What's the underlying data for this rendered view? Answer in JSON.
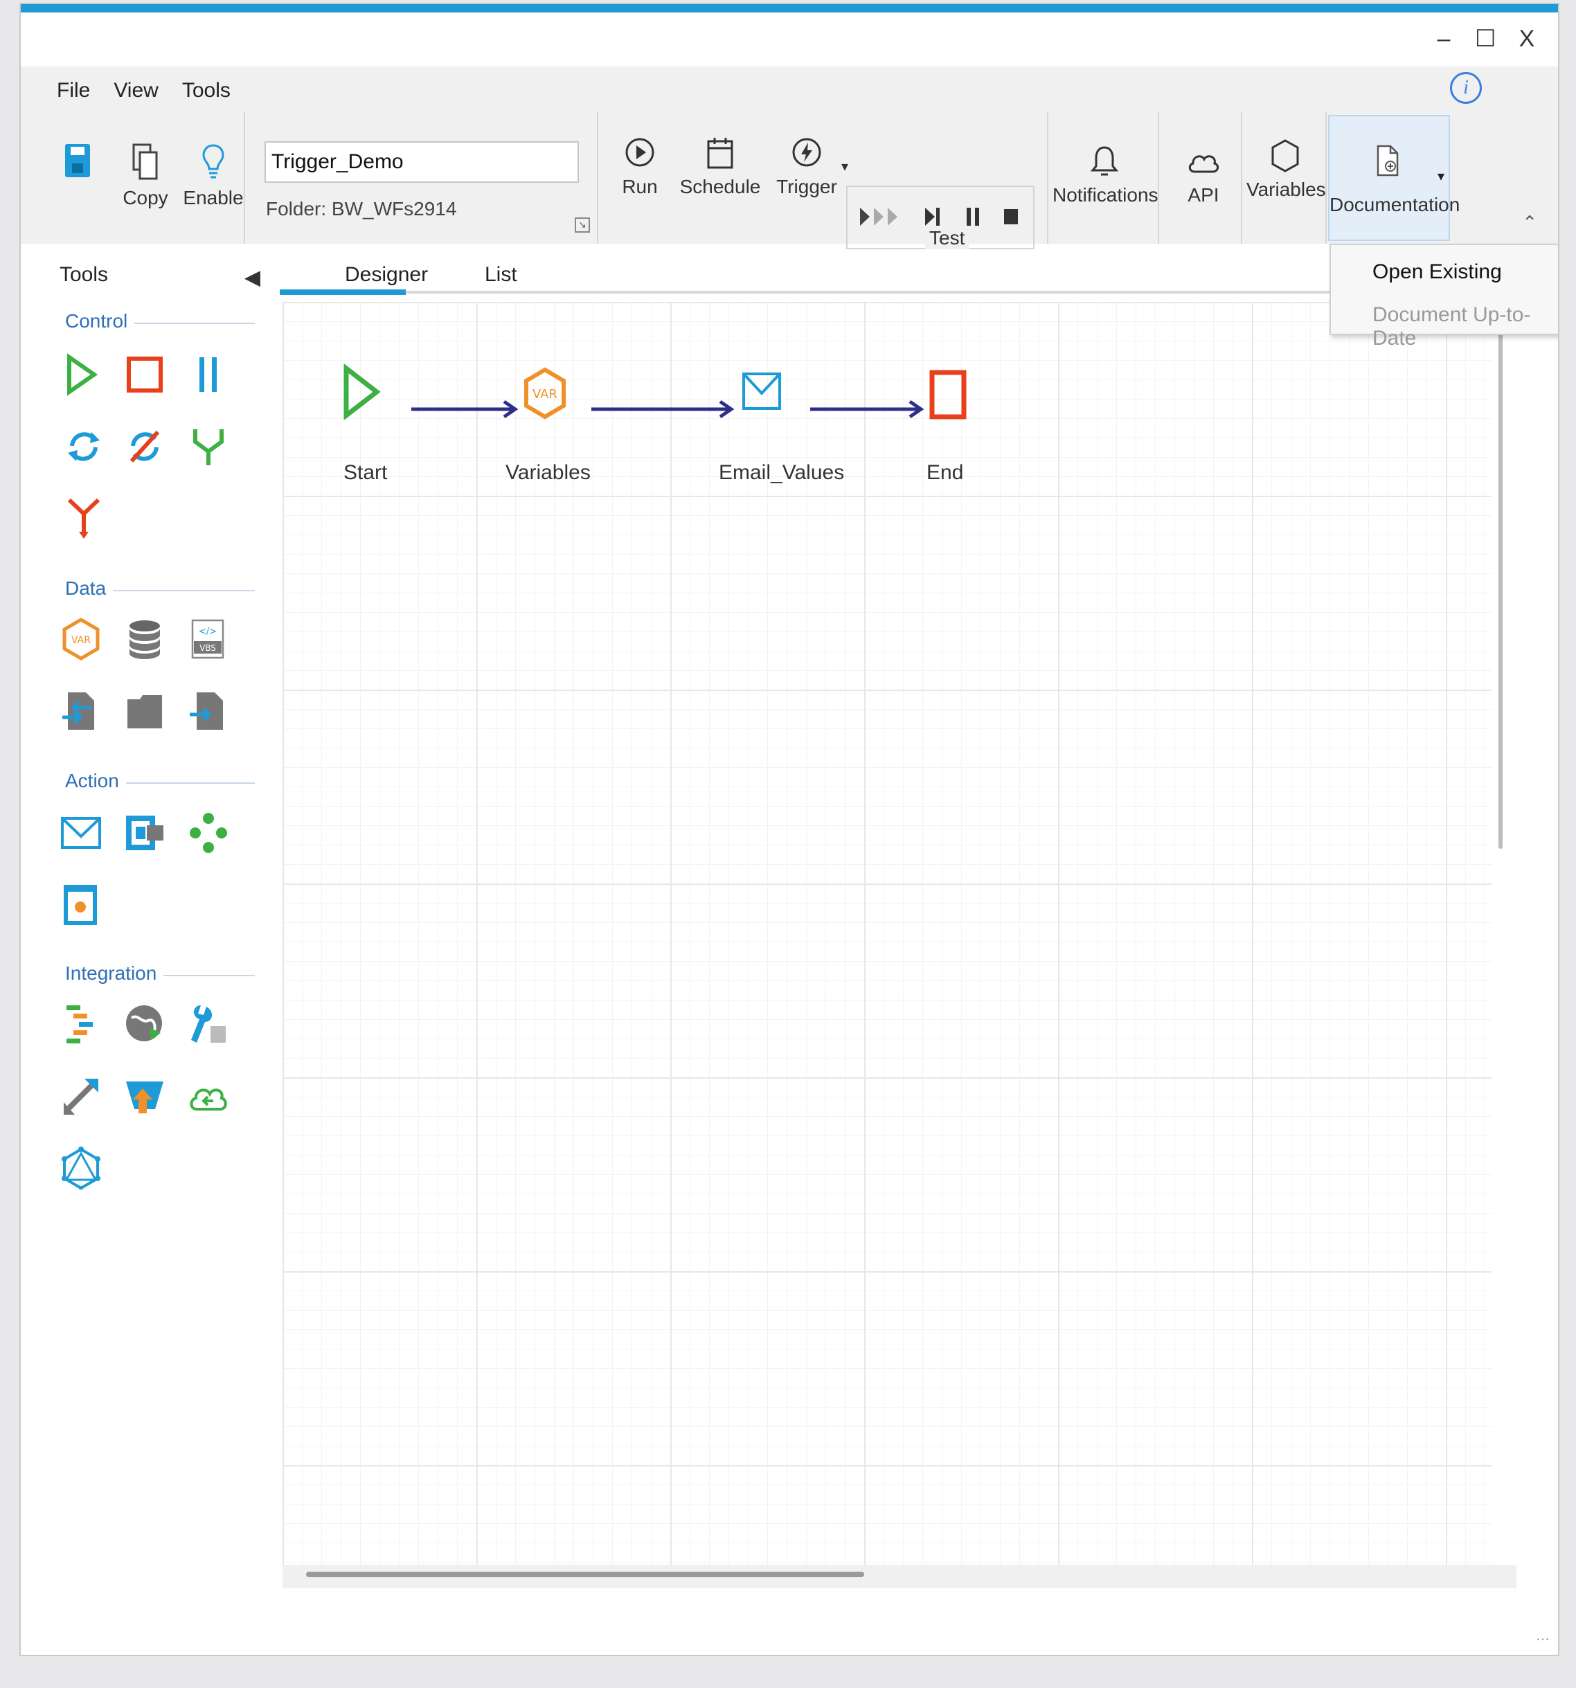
{
  "window": {
    "controls": {
      "minimize": "–",
      "maximize": "☐",
      "close": "X"
    }
  },
  "menu": [
    "File",
    "View",
    "Tools"
  ],
  "ribbon": {
    "copy_label": "Copy",
    "enable_label": "Enable",
    "workflow_name": "Trigger_Demo",
    "folder": "Folder: BW_WFs2914",
    "run_label": "Run",
    "schedule_label": "Schedule",
    "trigger_label": "Trigger",
    "test_label": "Test",
    "notifications_label": "Notifications",
    "api_label": "API",
    "variables_label": "Variables",
    "documentation_label": "Documentation"
  },
  "documentation_menu": {
    "open_existing": "Open Existing",
    "document_up_to_date": "Document Up-to-Date"
  },
  "toolbox": {
    "title": "Tools",
    "categories": {
      "control": "Control",
      "data": "Data",
      "action": "Action",
      "integration": "Integration"
    }
  },
  "tabs": {
    "designer": "Designer",
    "list": "List"
  },
  "workflow": {
    "nodes": [
      {
        "label": "Start"
      },
      {
        "label": "Variables"
      },
      {
        "label": "Email_Values"
      },
      {
        "label": "End"
      }
    ]
  },
  "colors": {
    "accent": "#1e9bd7",
    "start_green": "#3cb043",
    "end_red": "#e8401c",
    "var_orange": "#f0902a",
    "email_blue": "#1e9bd7",
    "connector": "#2b2f86"
  }
}
